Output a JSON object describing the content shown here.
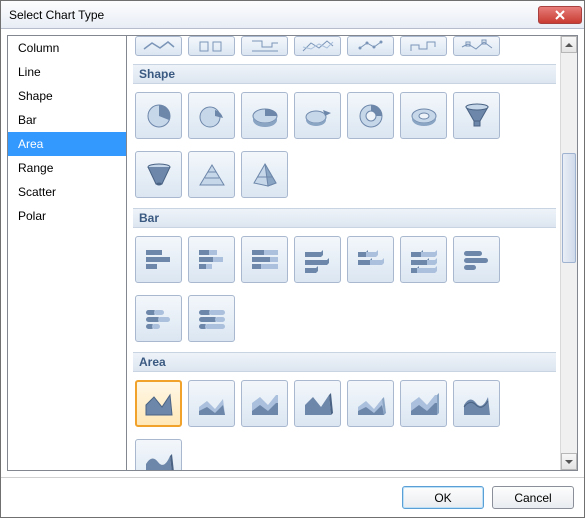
{
  "dialog": {
    "title": "Select Chart Type"
  },
  "sidebar": {
    "items": [
      "Column",
      "Line",
      "Shape",
      "Bar",
      "Area",
      "Range",
      "Scatter",
      "Polar"
    ],
    "selected": "Area"
  },
  "sections": {
    "shape": {
      "label": "Shape",
      "types": [
        "pie",
        "pie-exploded",
        "pie-3d",
        "pie-3d-exploded",
        "donut",
        "donut-3d",
        "funnel",
        "funnel-3d",
        "pyramid",
        "pyramid-3d"
      ]
    },
    "bar": {
      "label": "Bar",
      "types": [
        "bar",
        "bar-stacked",
        "bar-100stacked",
        "bar-3d",
        "bar-3d-stacked",
        "bar-3d-100stacked",
        "bar-cylinder",
        "bar-cylinder-stacked",
        "bar-cylinder-100stacked"
      ]
    },
    "area": {
      "label": "Area",
      "types": [
        "area",
        "area-stacked",
        "area-100stacked",
        "area-3d",
        "area-3d-stacked",
        "area-3d-100stacked",
        "area-spline",
        "area-spline-3d"
      ],
      "selected": "area"
    }
  },
  "buttons": {
    "ok": "OK",
    "cancel": "Cancel"
  },
  "colors": {
    "accent": "#3399ff",
    "icon_primary": "#6d87aa",
    "icon_secondary": "#aac0dc",
    "selection_border": "#f0a22b"
  }
}
